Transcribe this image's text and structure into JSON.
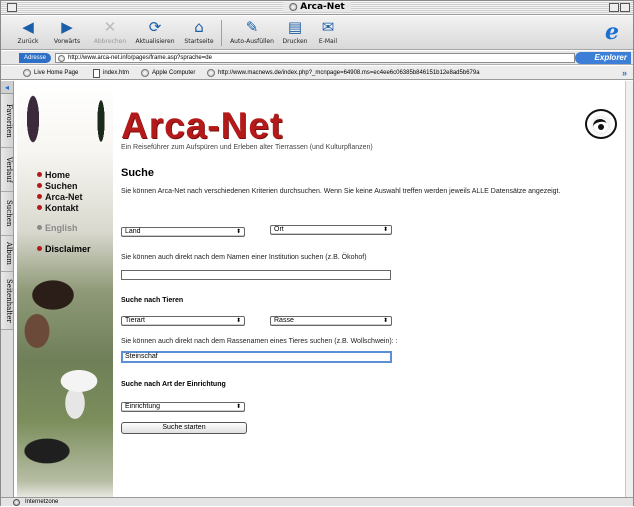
{
  "window": {
    "title": "Arca-Net"
  },
  "toolbar": {
    "buttons": [
      {
        "label": "Zurück",
        "icon": "back-arrow-icon"
      },
      {
        "label": "Vorwärts",
        "icon": "forward-arrow-icon"
      },
      {
        "label": "Abbrechen",
        "icon": "stop-icon"
      },
      {
        "label": "Aktualisieren",
        "icon": "refresh-icon"
      },
      {
        "label": "Startseite",
        "icon": "home-icon"
      },
      {
        "label": "Auto-Ausfüllen",
        "icon": "autofill-icon"
      },
      {
        "label": "Drucken",
        "icon": "print-icon"
      },
      {
        "label": "E-Mail",
        "icon": "mail-icon"
      }
    ]
  },
  "address": {
    "label": "Adresse",
    "url": "http://www.arca-net.info/pages/frame.asp?sprache=de",
    "brand": "Explorer"
  },
  "favorites": [
    {
      "label": "Live Home Page"
    },
    {
      "label": "index.htm"
    },
    {
      "label": "Apple Computer"
    },
    {
      "label": "http://www.macnews.de/index.php?_mcnpage=64908.ms=ec4ee6c06385b846151b12e8ad5b679a"
    }
  ],
  "sidetabs": [
    "Favoriten",
    "Verlauf",
    "Suchen",
    "Album",
    "Seitenhalter"
  ],
  "status": {
    "text": "Internetzone"
  },
  "site": {
    "logo": "Arca-Net",
    "tagline": "Ein Reiseführer zum Aufspüren und Erleben alter Tierrassen (und Kulturpflanzen)",
    "nav": [
      "Home",
      "Suchen",
      "Arca-Net",
      "Kontakt"
    ],
    "nav_english": "English",
    "nav_disclaimer": "Disclaimer"
  },
  "search": {
    "title": "Suche",
    "intro": "Sie können Arca-Net nach verschiedenen Kriterien durchsuchen. Wenn Sie keine Auswahl treffen werden jeweils ALLE Datensätze angezeigt.",
    "land_select": "Land",
    "ort_select": "Ort",
    "institution_hint": "Sie können auch direkt nach dem Namen einer Institution suchen (z.B. Ökohof)",
    "institution_value": "",
    "animals_heading": "Suche nach Tieren",
    "tierart_select": "Tierart",
    "rasse_select": "Rasse",
    "breed_hint": "Sie können auch direkt nach dem Rassenamen eines Tieres suchen (z.B. Wollschwein): :",
    "breed_value": "Steinschaf",
    "facility_heading": "Suche nach Art der Einrichtung",
    "einrichtung_select": "Einrichtung",
    "submit_label": "Suche starten"
  }
}
